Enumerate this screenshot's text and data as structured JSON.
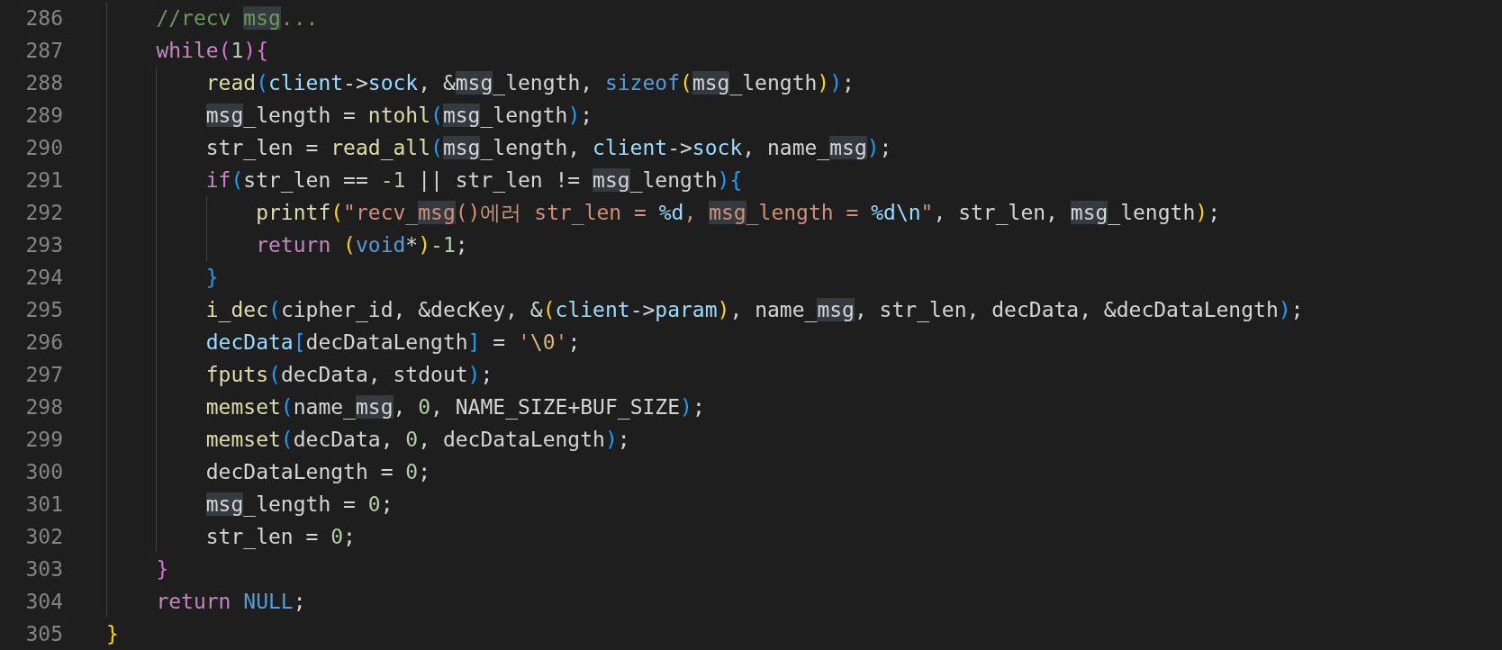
{
  "editor": {
    "lines": [
      {
        "children": [
          {
            "number": "286",
            "tokens": [
              {
                "text": "//recv ",
                "kind": "comment",
                "highlighted": false
              },
              {
                "text": "msg",
                "kind": "comment",
                "highlighted": true
              },
              {
                "text": "...",
                "kind": "comment",
                "highlighted": false
              }
            ]
          },
          {
            "number": "287",
            "tokens": [
              {
                "text": "while",
                "kind": "keyword",
                "highlighted": false
              },
              {
                "text": "(",
                "kind": "bracket2",
                "highlighted": false
              },
              {
                "text": "1",
                "kind": "number",
                "highlighted": false
              },
              {
                "text": "){",
                "kind": "bracket2",
                "highlighted": false
              }
            ],
            "children": [
              {
                "number": "288",
                "tokens": [
                  {
                    "text": "read",
                    "kind": "function",
                    "highlighted": false
                  },
                  {
                    "text": "(",
                    "kind": "bracket3",
                    "highlighted": false
                  },
                  {
                    "text": "client",
                    "kind": "variable",
                    "highlighted": false
                  },
                  {
                    "text": "->",
                    "kind": "plain",
                    "highlighted": false
                  },
                  {
                    "text": "sock",
                    "kind": "variable",
                    "highlighted": false
                  },
                  {
                    "text": ", &",
                    "kind": "plain",
                    "highlighted": false
                  },
                  {
                    "text": "msg",
                    "kind": "plain",
                    "highlighted": true
                  },
                  {
                    "text": "_length, ",
                    "kind": "plain",
                    "highlighted": false
                  },
                  {
                    "text": "sizeof",
                    "kind": "type",
                    "highlighted": false
                  },
                  {
                    "text": "(",
                    "kind": "bracket1",
                    "highlighted": false
                  },
                  {
                    "text": "msg",
                    "kind": "plain",
                    "highlighted": true
                  },
                  {
                    "text": "_length",
                    "kind": "plain",
                    "highlighted": false
                  },
                  {
                    "text": ")",
                    "kind": "bracket1",
                    "highlighted": false
                  },
                  {
                    "text": ")",
                    "kind": "bracket3",
                    "highlighted": false
                  },
                  {
                    "text": ";",
                    "kind": "plain",
                    "highlighted": false
                  }
                ]
              },
              {
                "number": "289",
                "tokens": [
                  {
                    "text": "msg",
                    "kind": "plain",
                    "highlighted": true
                  },
                  {
                    "text": "_length = ",
                    "kind": "plain",
                    "highlighted": false
                  },
                  {
                    "text": "ntohl",
                    "kind": "function",
                    "highlighted": false
                  },
                  {
                    "text": "(",
                    "kind": "bracket3",
                    "highlighted": false
                  },
                  {
                    "text": "msg",
                    "kind": "plain",
                    "highlighted": true
                  },
                  {
                    "text": "_length",
                    "kind": "plain",
                    "highlighted": false
                  },
                  {
                    "text": ")",
                    "kind": "bracket3",
                    "highlighted": false
                  },
                  {
                    "text": ";",
                    "kind": "plain",
                    "highlighted": false
                  }
                ]
              },
              {
                "number": "290",
                "tokens": [
                  {
                    "text": "str_len = ",
                    "kind": "plain",
                    "highlighted": false
                  },
                  {
                    "text": "read_all",
                    "kind": "function",
                    "highlighted": false
                  },
                  {
                    "text": "(",
                    "kind": "bracket3",
                    "highlighted": false
                  },
                  {
                    "text": "msg",
                    "kind": "plain",
                    "highlighted": true
                  },
                  {
                    "text": "_length, ",
                    "kind": "plain",
                    "highlighted": false
                  },
                  {
                    "text": "client",
                    "kind": "variable",
                    "highlighted": false
                  },
                  {
                    "text": "->",
                    "kind": "plain",
                    "highlighted": false
                  },
                  {
                    "text": "sock",
                    "kind": "variable",
                    "highlighted": false
                  },
                  {
                    "text": ", name_",
                    "kind": "plain",
                    "highlighted": false
                  },
                  {
                    "text": "msg",
                    "kind": "plain",
                    "highlighted": true
                  },
                  {
                    "text": ")",
                    "kind": "bracket3",
                    "highlighted": false
                  },
                  {
                    "text": ";",
                    "kind": "plain",
                    "highlighted": false
                  }
                ]
              },
              {
                "number": "291",
                "tokens": [
                  {
                    "text": "if",
                    "kind": "keyword",
                    "highlighted": false
                  },
                  {
                    "text": "(",
                    "kind": "bracket3",
                    "highlighted": false
                  },
                  {
                    "text": "str_len == ",
                    "kind": "plain",
                    "highlighted": false
                  },
                  {
                    "text": "-1",
                    "kind": "number",
                    "highlighted": false
                  },
                  {
                    "text": " || str_len != ",
                    "kind": "plain",
                    "highlighted": false
                  },
                  {
                    "text": "msg",
                    "kind": "plain",
                    "highlighted": true
                  },
                  {
                    "text": "_length",
                    "kind": "plain",
                    "highlighted": false
                  },
                  {
                    "text": "){",
                    "kind": "bracket3",
                    "highlighted": false
                  }
                ],
                "children": [
                  {
                    "number": "292",
                    "tokens": [
                      {
                        "text": "printf",
                        "kind": "function",
                        "highlighted": false
                      },
                      {
                        "text": "(",
                        "kind": "bracket1",
                        "highlighted": false
                      },
                      {
                        "text": "\"recv_",
                        "kind": "string",
                        "highlighted": false
                      },
                      {
                        "text": "msg",
                        "kind": "string",
                        "highlighted": true
                      },
                      {
                        "text": "()에러 str_len = ",
                        "kind": "string",
                        "highlighted": false
                      },
                      {
                        "text": "%d",
                        "kind": "format",
                        "highlighted": false
                      },
                      {
                        "text": ", ",
                        "kind": "string",
                        "highlighted": false
                      },
                      {
                        "text": "msg",
                        "kind": "string",
                        "highlighted": true
                      },
                      {
                        "text": "_length = ",
                        "kind": "string",
                        "highlighted": false
                      },
                      {
                        "text": "%d\\n",
                        "kind": "format",
                        "highlighted": false
                      },
                      {
                        "text": "\"",
                        "kind": "string",
                        "highlighted": false
                      },
                      {
                        "text": ", str_len, ",
                        "kind": "plain",
                        "highlighted": false
                      },
                      {
                        "text": "msg",
                        "kind": "plain",
                        "highlighted": true
                      },
                      {
                        "text": "_length",
                        "kind": "plain",
                        "highlighted": false
                      },
                      {
                        "text": ")",
                        "kind": "bracket1",
                        "highlighted": false
                      },
                      {
                        "text": ";",
                        "kind": "plain",
                        "highlighted": false
                      }
                    ]
                  },
                  {
                    "number": "293",
                    "tokens": [
                      {
                        "text": "return ",
                        "kind": "keyword",
                        "highlighted": false
                      },
                      {
                        "text": "(",
                        "kind": "bracket1",
                        "highlighted": false
                      },
                      {
                        "text": "void",
                        "kind": "type",
                        "highlighted": false
                      },
                      {
                        "text": "*",
                        "kind": "plain",
                        "highlighted": false
                      },
                      {
                        "text": ")",
                        "kind": "bracket1",
                        "highlighted": false
                      },
                      {
                        "text": "-1",
                        "kind": "number",
                        "highlighted": false
                      },
                      {
                        "text": ";",
                        "kind": "plain",
                        "highlighted": false
                      }
                    ]
                  }
                ]
              },
              {
                "number": "294",
                "tokens": [
                  {
                    "text": "}",
                    "kind": "bracket3",
                    "highlighted": false
                  }
                ]
              },
              {
                "number": "295",
                "tokens": [
                  {
                    "text": "i_dec",
                    "kind": "function",
                    "highlighted": false
                  },
                  {
                    "text": "(",
                    "kind": "bracket3",
                    "highlighted": false
                  },
                  {
                    "text": "cipher_id, &decKey, &",
                    "kind": "plain",
                    "highlighted": false
                  },
                  {
                    "text": "(",
                    "kind": "bracket1",
                    "highlighted": false
                  },
                  {
                    "text": "client",
                    "kind": "variable",
                    "highlighted": false
                  },
                  {
                    "text": "->",
                    "kind": "plain",
                    "highlighted": false
                  },
                  {
                    "text": "param",
                    "kind": "variable",
                    "highlighted": false
                  },
                  {
                    "text": ")",
                    "kind": "bracket1",
                    "highlighted": false
                  },
                  {
                    "text": ", name_",
                    "kind": "plain",
                    "highlighted": false
                  },
                  {
                    "text": "msg",
                    "kind": "plain",
                    "highlighted": true
                  },
                  {
                    "text": ", str_len, decData, &decDataLength",
                    "kind": "plain",
                    "highlighted": false
                  },
                  {
                    "text": ")",
                    "kind": "bracket3",
                    "highlighted": false
                  },
                  {
                    "text": ";",
                    "kind": "plain",
                    "highlighted": false
                  }
                ]
              },
              {
                "number": "296",
                "tokens": [
                  {
                    "text": "decData",
                    "kind": "variable",
                    "highlighted": false
                  },
                  {
                    "text": "[",
                    "kind": "bracket3",
                    "highlighted": false
                  },
                  {
                    "text": "decDataLength",
                    "kind": "plain",
                    "highlighted": false
                  },
                  {
                    "text": "]",
                    "kind": "bracket3",
                    "highlighted": false
                  },
                  {
                    "text": " = ",
                    "kind": "plain",
                    "highlighted": false
                  },
                  {
                    "text": "'",
                    "kind": "string",
                    "highlighted": false
                  },
                  {
                    "text": "\\0",
                    "kind": "escape",
                    "highlighted": false
                  },
                  {
                    "text": "'",
                    "kind": "string",
                    "highlighted": false
                  },
                  {
                    "text": ";",
                    "kind": "plain",
                    "highlighted": false
                  }
                ]
              },
              {
                "number": "297",
                "tokens": [
                  {
                    "text": "fputs",
                    "kind": "function",
                    "highlighted": false
                  },
                  {
                    "text": "(",
                    "kind": "bracket3",
                    "highlighted": false
                  },
                  {
                    "text": "decData, stdout",
                    "kind": "plain",
                    "highlighted": false
                  },
                  {
                    "text": ")",
                    "kind": "bracket3",
                    "highlighted": false
                  },
                  {
                    "text": ";",
                    "kind": "plain",
                    "highlighted": false
                  }
                ]
              },
              {
                "number": "298",
                "tokens": [
                  {
                    "text": "memset",
                    "kind": "function",
                    "highlighted": false
                  },
                  {
                    "text": "(",
                    "kind": "bracket3",
                    "highlighted": false
                  },
                  {
                    "text": "name_",
                    "kind": "plain",
                    "highlighted": false
                  },
                  {
                    "text": "msg",
                    "kind": "plain",
                    "highlighted": true
                  },
                  {
                    "text": ", ",
                    "kind": "plain",
                    "highlighted": false
                  },
                  {
                    "text": "0",
                    "kind": "number",
                    "highlighted": false
                  },
                  {
                    "text": ", NAME_SIZE+BUF_SIZE",
                    "kind": "plain",
                    "highlighted": false
                  },
                  {
                    "text": ")",
                    "kind": "bracket3",
                    "highlighted": false
                  },
                  {
                    "text": ";",
                    "kind": "plain",
                    "highlighted": false
                  }
                ]
              },
              {
                "number": "299",
                "tokens": [
                  {
                    "text": "memset",
                    "kind": "function",
                    "highlighted": false
                  },
                  {
                    "text": "(",
                    "kind": "bracket3",
                    "highlighted": false
                  },
                  {
                    "text": "decData, ",
                    "kind": "plain",
                    "highlighted": false
                  },
                  {
                    "text": "0",
                    "kind": "number",
                    "highlighted": false
                  },
                  {
                    "text": ", decDataLength",
                    "kind": "plain",
                    "highlighted": false
                  },
                  {
                    "text": ")",
                    "kind": "bracket3",
                    "highlighted": false
                  },
                  {
                    "text": ";",
                    "kind": "plain",
                    "highlighted": false
                  }
                ]
              },
              {
                "number": "300",
                "tokens": [
                  {
                    "text": "decDataLength = ",
                    "kind": "plain",
                    "highlighted": false
                  },
                  {
                    "text": "0",
                    "kind": "number",
                    "highlighted": false
                  },
                  {
                    "text": ";",
                    "kind": "plain",
                    "highlighted": false
                  }
                ]
              },
              {
                "number": "301",
                "tokens": [
                  {
                    "text": "msg",
                    "kind": "plain",
                    "highlighted": true
                  },
                  {
                    "text": "_length = ",
                    "kind": "plain",
                    "highlighted": false
                  },
                  {
                    "text": "0",
                    "kind": "number",
                    "highlighted": false
                  },
                  {
                    "text": ";",
                    "kind": "plain",
                    "highlighted": false
                  }
                ]
              },
              {
                "number": "302",
                "tokens": [
                  {
                    "text": "str_len = ",
                    "kind": "plain",
                    "highlighted": false
                  },
                  {
                    "text": "0",
                    "kind": "number",
                    "highlighted": false
                  },
                  {
                    "text": ";",
                    "kind": "plain",
                    "highlighted": false
                  }
                ]
              }
            ]
          },
          {
            "number": "303",
            "tokens": [
              {
                "text": "}",
                "kind": "bracket2",
                "highlighted": false
              }
            ]
          },
          {
            "number": "304",
            "tokens": [
              {
                "text": "return ",
                "kind": "keyword",
                "highlighted": false
              },
              {
                "text": "NULL",
                "kind": "type",
                "highlighted": false
              },
              {
                "text": ";",
                "kind": "plain",
                "highlighted": false
              }
            ]
          }
        ]
      },
      {
        "number": "305",
        "tokens": [
          {
            "text": "}",
            "kind": "bracket1",
            "highlighted": false
          }
        ]
      }
    ]
  }
}
